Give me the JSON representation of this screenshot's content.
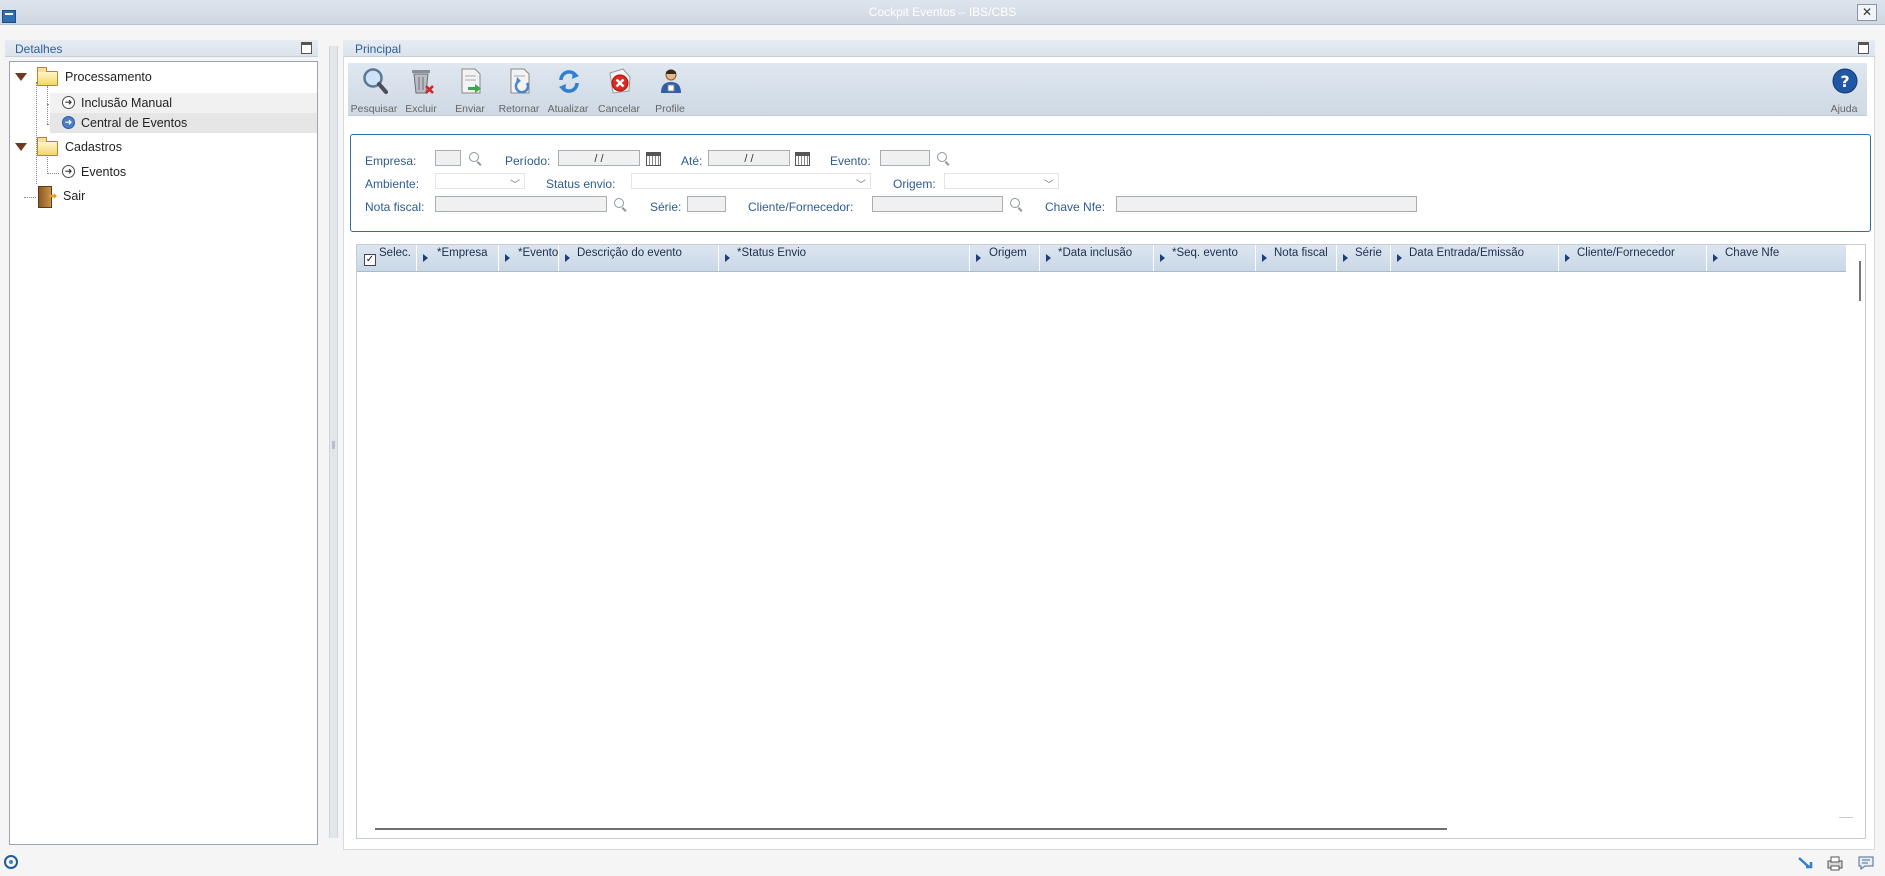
{
  "window": {
    "title": "Cockpit Eventos – IBS/CBS",
    "close_symbol": "✕"
  },
  "left_panel": {
    "title": "Detalhes",
    "tree": [
      {
        "label": "Processamento",
        "type": "folder"
      },
      {
        "label": "Inclusão Manual",
        "type": "item"
      },
      {
        "label": "Central de Eventos",
        "type": "item",
        "selected": true
      },
      {
        "label": "Cadastros",
        "type": "folder"
      },
      {
        "label": "Eventos",
        "type": "item"
      },
      {
        "label": "Sair",
        "type": "exit"
      }
    ]
  },
  "right_panel": {
    "title": "Principal",
    "toolbar": {
      "buttons": [
        {
          "label": "Pesquisar",
          "icon": "magnifier-icon"
        },
        {
          "label": "Excluir",
          "icon": "trash-icon"
        },
        {
          "label": "Enviar",
          "icon": "send-document-icon"
        },
        {
          "label": "Retornar",
          "icon": "return-document-icon"
        },
        {
          "label": "Atualizar",
          "icon": "refresh-icon"
        },
        {
          "label": "Cancelar",
          "icon": "cancel-icon"
        },
        {
          "label": "Profile",
          "icon": "user-profile-icon"
        }
      ],
      "help_label": "Ajuda"
    },
    "filters": {
      "empresa_label": "Empresa:",
      "periodo_label": "Período:",
      "periodo_value": " / /",
      "ate_label": "Até:",
      "ate_value": " / /",
      "evento_label": "Evento:",
      "ambiente_label": "Ambiente:",
      "status_label": "Status envio:",
      "origem_label": "Origem:",
      "nota_label": "Nota fiscal:",
      "serie_label": "Série:",
      "cliente_label": "Cliente/Fornecedor:",
      "chave_label": "Chave Nfe:"
    },
    "grid": {
      "columns": [
        "Selec.",
        "*Empresa",
        "*Evento",
        "Descrição do evento",
        "*Status Envio",
        "Origem",
        "*Data inclusão",
        "*Seq. evento",
        "Nota fiscal",
        "Série",
        "Data Entrada/Emissão",
        "Cliente/Fornecedor",
        "Chave Nfe"
      ],
      "rows": []
    }
  },
  "colors": {
    "accent": "#2d6da8",
    "header_bg": "#cfd9e4",
    "label_blue": "#2d5b94"
  }
}
